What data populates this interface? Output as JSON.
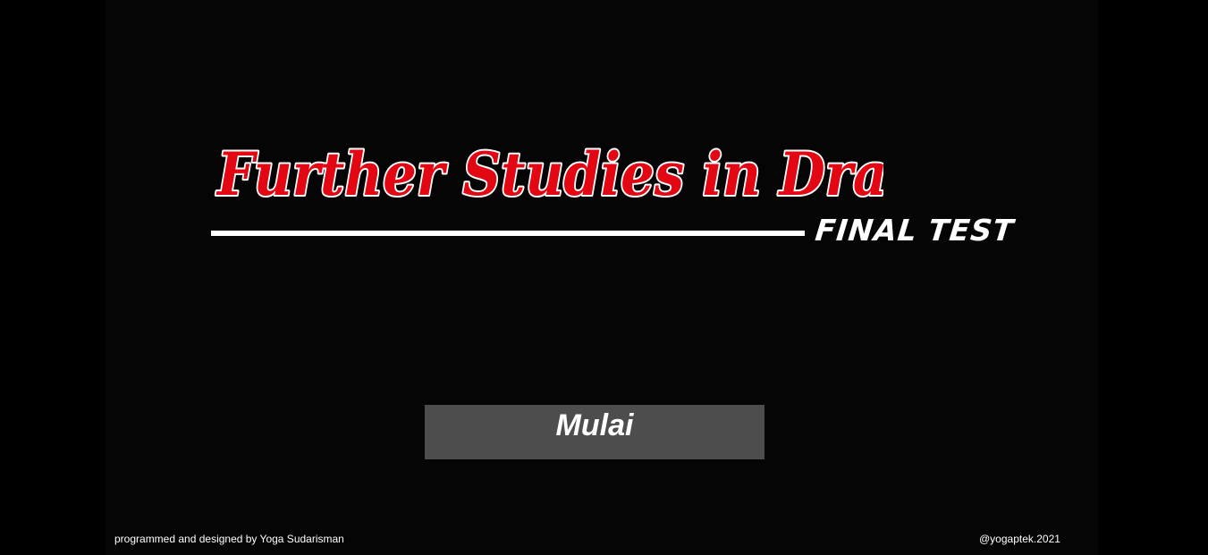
{
  "title": {
    "main": "Further Studies in Drama",
    "subtitle": "FINAL TEST",
    "main_color": "#e30613",
    "outline_color": "#ffffff"
  },
  "actions": {
    "start_label": "Mulai"
  },
  "footer": {
    "credit": "programmed and designed by Yoga Sudarisman",
    "handle": "@yogaptek.2021"
  },
  "colors": {
    "background": "#050505",
    "button_bg": "#4d4d4d",
    "text": "#ffffff"
  }
}
